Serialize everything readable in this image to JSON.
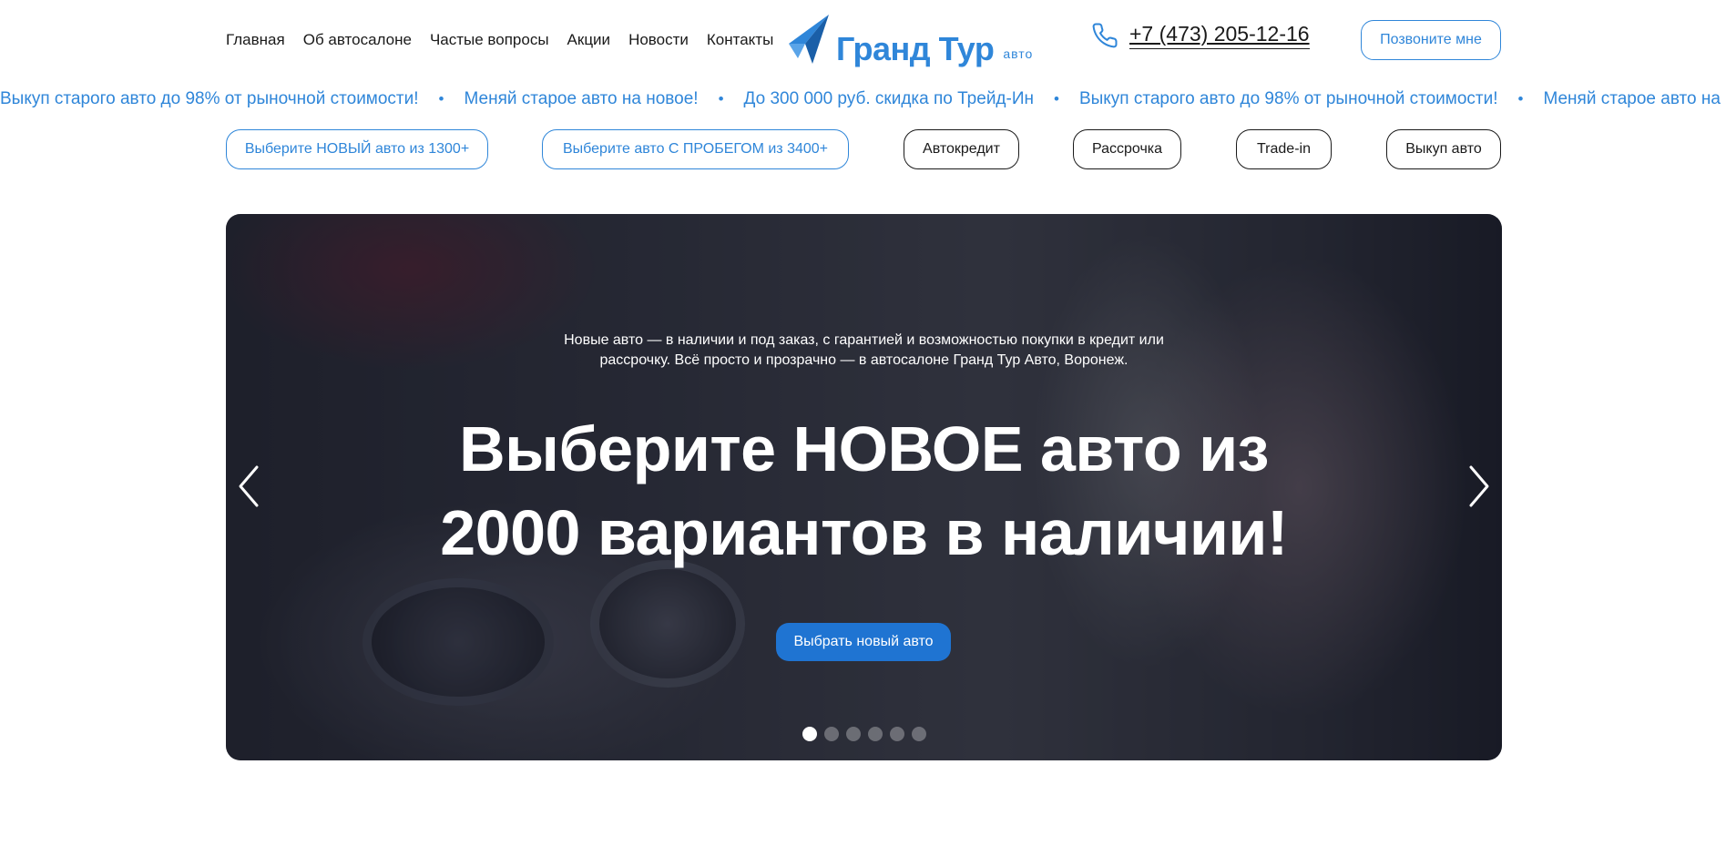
{
  "header": {
    "nav": [
      "Главная",
      "Об автосалоне",
      "Частые вопросы",
      "Акции",
      "Новости",
      "Контакты"
    ],
    "logo_text": "Гранд Тур",
    "logo_sub": "авто",
    "phone": "+7 (473) 205-12-16",
    "callback_label": "Позвоните мне"
  },
  "ticker": {
    "items": [
      "Выкуп старого авто до 98% от рыночной стоимости!",
      "Меняй старое авто на новое!",
      "До 300 000 руб. скидка по Трейд-Ин",
      "Выкуп старого авто до 98% от рыночной стоимости!",
      "Меняй старое авто на новое!"
    ],
    "separator": "•"
  },
  "categories": [
    "Выберите НОВЫЙ авто из 1300+",
    "Выберите авто С ПРОБЕГОМ из 3400+",
    "Автокредит",
    "Рассрочка",
    "Trade-in",
    "Выкуп авто"
  ],
  "hero": {
    "subtitle_line1": "Новые авто — в наличии и под заказ, с гарантией и возможностью покупки в кредит или",
    "subtitle_line2": "рассрочку. Всё просто и прозрачно — в автосалоне Гранд Тур Авто, Воронеж.",
    "title_line1": "Выберите НОВОЕ авто из",
    "title_line2": "2000 вариантов в наличии!",
    "button_label": "Выбрать новый авто",
    "slide_count": 6,
    "active_slide": 1
  },
  "colors": {
    "accent": "#2f86d9",
    "button": "#1f74d2",
    "text": "#1a1a1a"
  },
  "icons": {
    "phone": "phone-icon",
    "logo": "logo-arrow-icon",
    "prev": "chevron-left-icon",
    "next": "chevron-right-icon"
  }
}
